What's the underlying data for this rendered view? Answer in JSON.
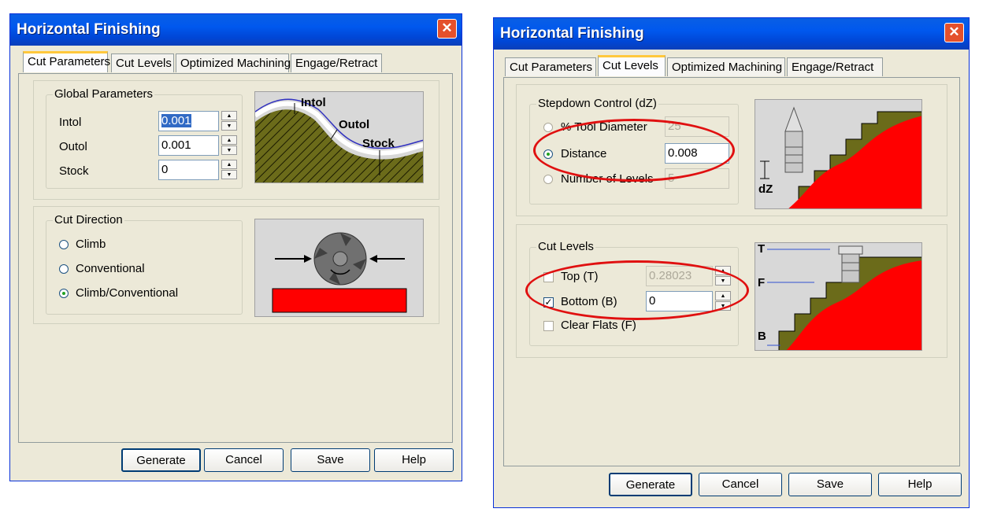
{
  "left_dialog": {
    "title": "Horizontal Finishing",
    "tabs": [
      "Cut Parameters",
      "Cut Levels",
      "Optimized Machining",
      "Engage/Retract"
    ],
    "active_tab": "Cut Parameters",
    "global_params": {
      "legend": "Global Parameters",
      "intol_label": "Intol",
      "intol_value": "0.001",
      "outol_label": "Outol",
      "outol_value": "0.001",
      "stock_label": "Stock",
      "stock_value": "0"
    },
    "diagram": {
      "intol": "Intol",
      "outol": "Outol",
      "stock": "Stock"
    },
    "cut_direction": {
      "legend": "Cut Direction",
      "options": [
        "Climb",
        "Conventional",
        "Climb/Conventional"
      ],
      "selected": "Climb/Conventional"
    },
    "buttons": [
      "Generate",
      "Cancel",
      "Save",
      "Help"
    ]
  },
  "right_dialog": {
    "title": "Horizontal Finishing",
    "tabs": [
      "Cut Parameters",
      "Cut Levels",
      "Optimized Machining",
      "Engage/Retract"
    ],
    "active_tab": "Cut Levels",
    "stepdown": {
      "legend": "Stepdown Control (dZ)",
      "tool_dia_label": "% Tool Diameter",
      "tool_dia_value": "25",
      "distance_label": "Distance",
      "distance_value": "0.008",
      "levels_label": "Number of Levels",
      "levels_value": "5",
      "selected": "Distance"
    },
    "stepdown_diagram": {
      "dz": "dZ"
    },
    "cut_levels": {
      "legend": "Cut Levels",
      "top_label": "Top (T)",
      "top_value": "0.28023",
      "top_checked": false,
      "bottom_label": "Bottom (B)",
      "bottom_value": "0",
      "bottom_checked": true,
      "clear_flats_label": "Clear Flats (F)",
      "clear_flats_checked": false
    },
    "levels_diagram": {
      "t": "T",
      "f": "F",
      "b": "B"
    },
    "buttons": [
      "Generate",
      "Cancel",
      "Save",
      "Help"
    ]
  },
  "colors": {
    "highlight_ellipse": "#E01010",
    "stock_red": "#FF0000",
    "olive": "#6B6B1A"
  }
}
